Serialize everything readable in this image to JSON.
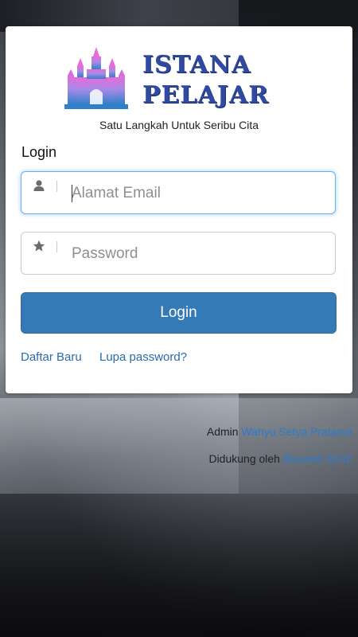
{
  "app": {
    "name_line1": "ISTANA",
    "name_line2": "PELAJAR",
    "tagline": "Satu Langkah Untuk Seribu Cita"
  },
  "login": {
    "heading": "Login",
    "email": {
      "placeholder": "Alamat Email",
      "value": "",
      "icon": "user-icon"
    },
    "password": {
      "placeholder": "Password",
      "value": "",
      "icon": "star-icon"
    },
    "submit_label": "Login",
    "register_link": "Daftar Baru",
    "forgot_link": "Lupa password?"
  },
  "footer": {
    "admin_prefix": "Admin",
    "admin_name": "Wahyu Setya Pratama",
    "support_prefix": "Didukung oleh",
    "support_name": "Bisasoft QUIZ"
  },
  "colors": {
    "brand_text": "#2f4aa0",
    "primary_button": "#337ab7",
    "link": "#2a6ab1",
    "focus_border": "#66afe9"
  }
}
